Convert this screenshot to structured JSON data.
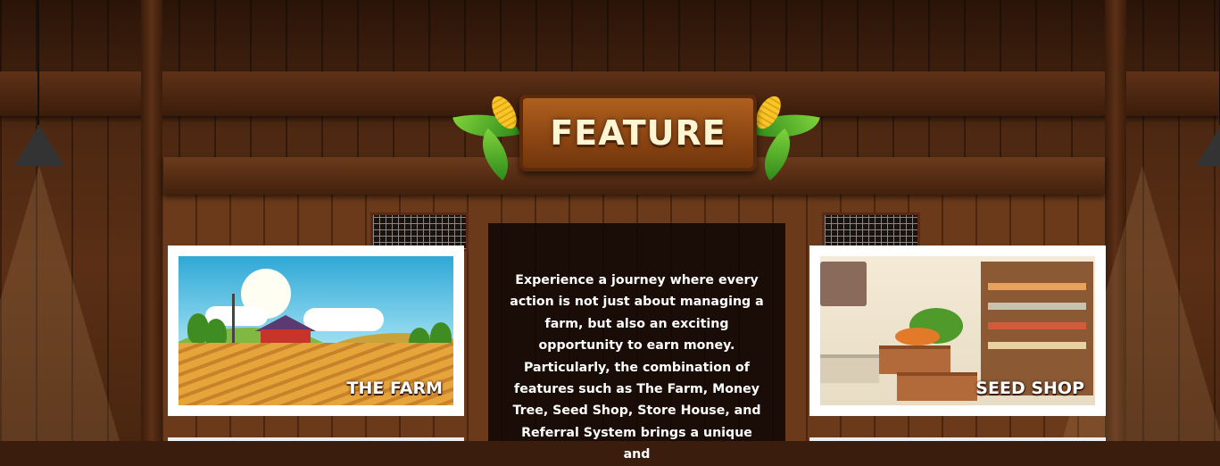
{
  "header": {
    "title": "FEATURE"
  },
  "features": {
    "farm": {
      "label": "THE FARM"
    },
    "shop": {
      "label": "SEED SHOP"
    }
  },
  "description": "Experience a journey where every action is not just about managing a farm, but also an exciting opportunity to earn money. Particularly, the combination of features such as The Farm, Money Tree, Seed Shop, Store House, and Referral System brings a unique and",
  "colors": {
    "sign": "#8a4412",
    "panel": "#120804",
    "text": "#ffffff"
  }
}
